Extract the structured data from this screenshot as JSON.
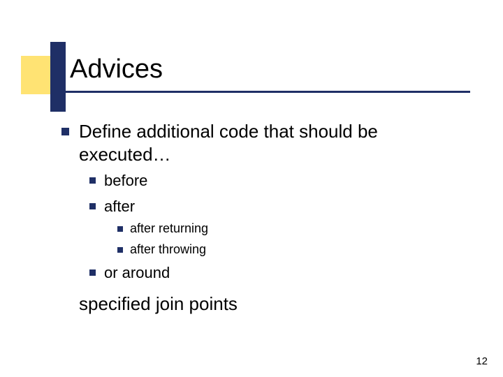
{
  "slide": {
    "title": "Advices",
    "main_bullet": "Define additional code that should be executed…",
    "sub_bullets": {
      "b1": "before",
      "b2": "after",
      "b2_children": {
        "c1": "after returning",
        "c2": "after throwing"
      },
      "b3": "or around"
    },
    "closing": "specified join points",
    "page_number": "12"
  }
}
